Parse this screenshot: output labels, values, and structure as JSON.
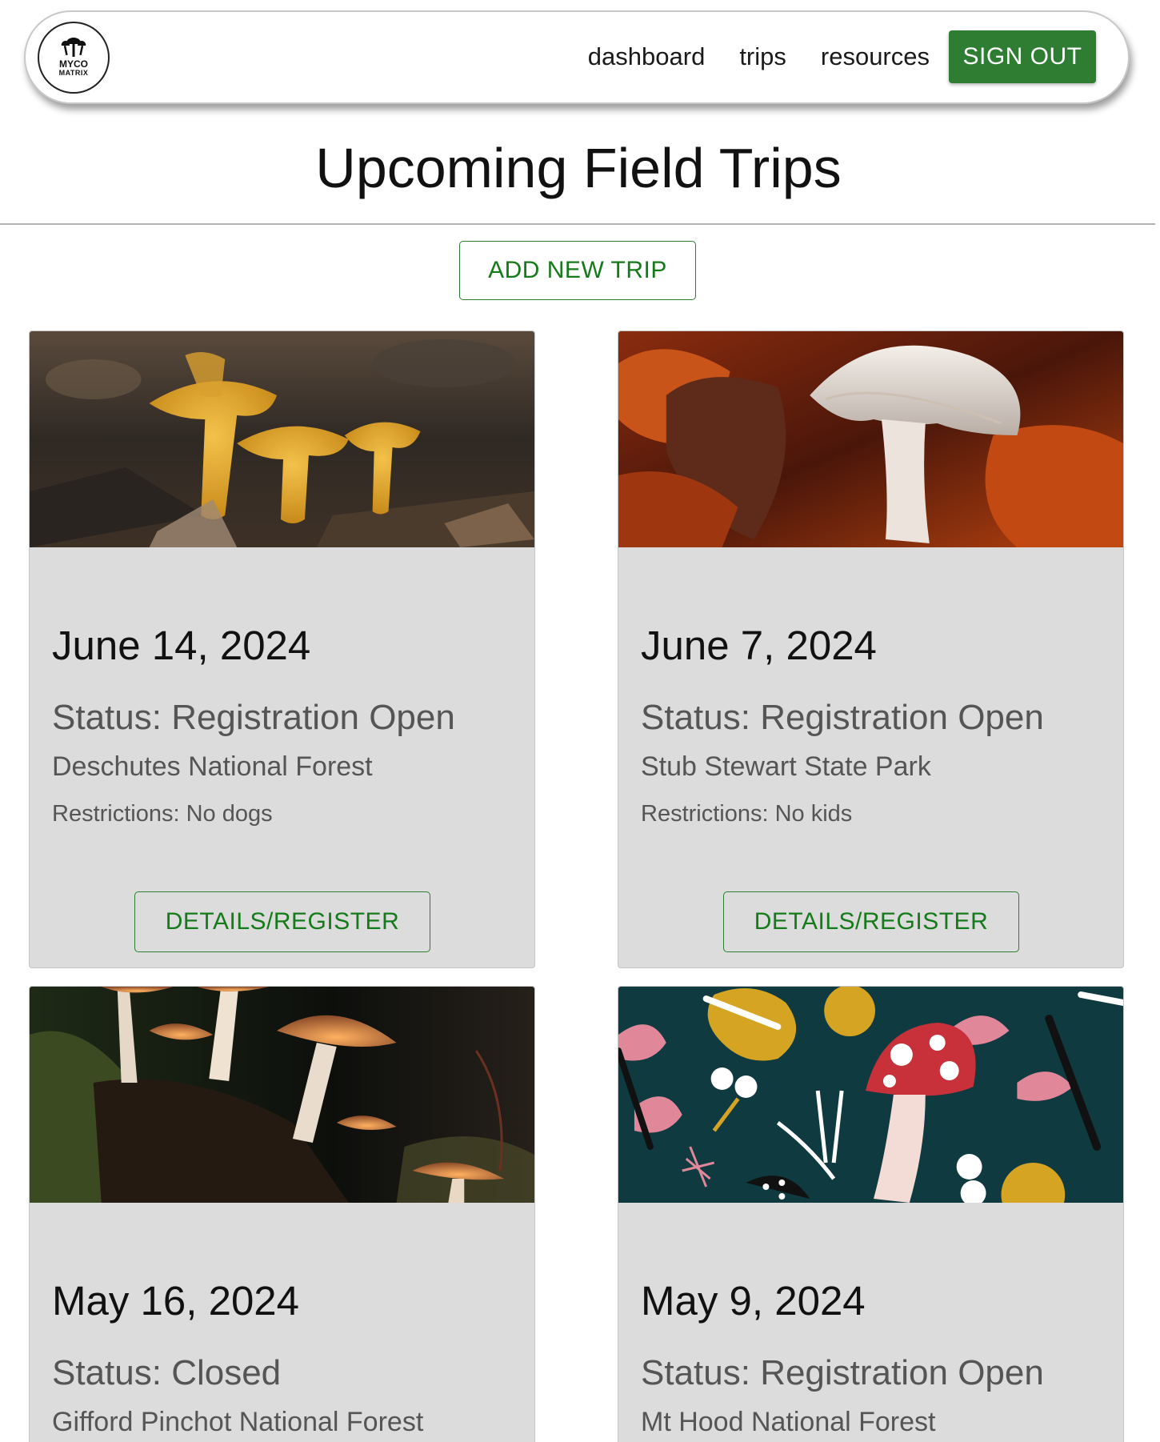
{
  "nav": {
    "logo_line1": "MYCO",
    "logo_line2": "MATRIX",
    "links": [
      "dashboard",
      "trips",
      "resources"
    ],
    "signout_label": "SIGN OUT"
  },
  "page": {
    "title": "Upcoming Field Trips",
    "add_trip_label": "ADD NEW TRIP"
  },
  "trips": [
    {
      "date": "June 14, 2024",
      "status": "Status: Registration Open",
      "location": "Deschutes National Forest",
      "restrictions": "Restrictions: No dogs",
      "button": "DETAILS/REGISTER",
      "image": "golden-chanterelle-photo"
    },
    {
      "date": "June 7, 2024",
      "status": "Status: Registration Open",
      "location": "Stub Stewart State Park",
      "restrictions": "Restrictions: No kids",
      "button": "DETAILS/REGISTER",
      "image": "white-oyster-mushroom-photo"
    },
    {
      "date": "May 16, 2024",
      "status": "Status: Closed",
      "location": "Gifford Pinchot National Forest",
      "restrictions": "",
      "button": "",
      "image": "glowing-mushrooms-photo"
    },
    {
      "date": "May 9, 2024",
      "status": "Status: Registration Open",
      "location": "Mt Hood National Forest",
      "restrictions": "",
      "button": "",
      "image": "illustrated-amanita-pattern"
    }
  ],
  "colors": {
    "primary_green": "#2e7d32",
    "card_bg": "#dcdcdc"
  }
}
